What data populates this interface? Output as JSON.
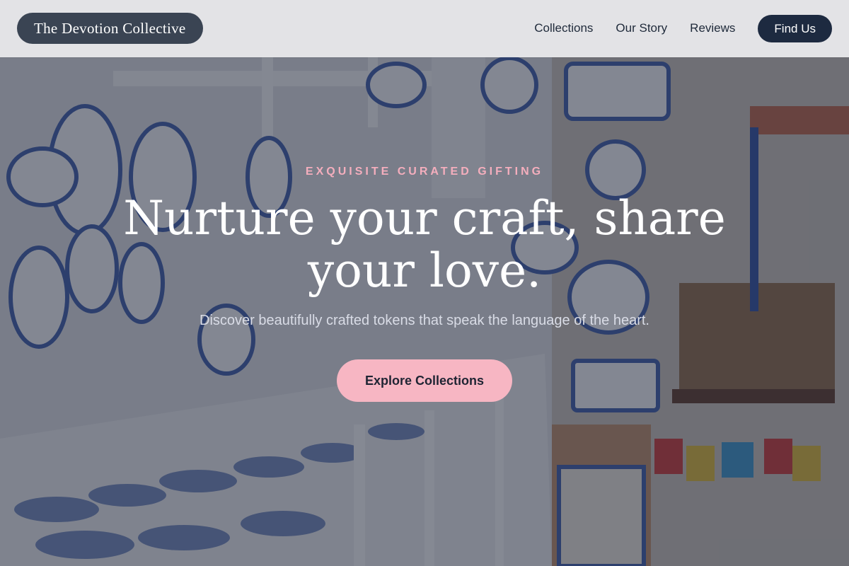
{
  "header": {
    "brand": "The Devotion Collective",
    "nav": [
      "Collections",
      "Our Story",
      "Reviews"
    ],
    "cta": "Find Us"
  },
  "hero": {
    "eyebrow": "EXQUISITE CURATED GIFTING",
    "headline": "Nurture your craft, share your love.",
    "subhead": "Discover beautifully crafted tokens that speak the language of the heart.",
    "cta": "Explore Collections",
    "background_image": "ceramics shop wall with hand-painted blue-and-white plates"
  },
  "colors": {
    "brand_pill": "#3a4453",
    "nav_cta": "#1d2a40",
    "accent_pink": "#f7b6c3",
    "eyebrow_pink": "#f4aebd"
  }
}
